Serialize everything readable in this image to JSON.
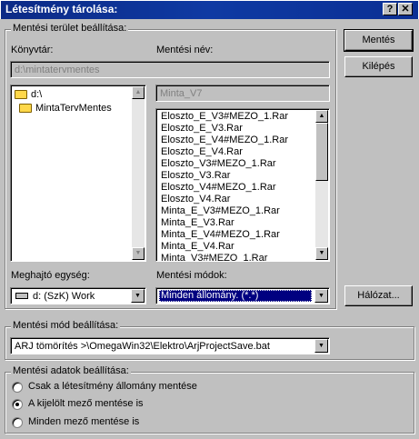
{
  "window": {
    "title": "Létesítmény tárolása:",
    "help_button": "?",
    "close_button": "✕"
  },
  "storage_area": {
    "legend": "Mentési terület beállítása:",
    "directory_label": "Könyvtár:",
    "directory_value": "d:\\mintatervmentes",
    "save_name_label": "Mentési név:",
    "save_name_value": "Minta_V7",
    "folders": [
      "d:\\",
      "MintaTervMentes"
    ],
    "files": [
      "Eloszto_E_V3#MEZO_1.Rar",
      "Eloszto_E_V3.Rar",
      "Eloszto_E_V4#MEZO_1.Rar",
      "Eloszto_E_V4.Rar",
      "Eloszto_V3#MEZO_1.Rar",
      "Eloszto_V3.Rar",
      "Eloszto_V4#MEZO_1.Rar",
      "Eloszto_V4.Rar",
      "Minta_E_V3#MEZO_1.Rar",
      "Minta_E_V3.Rar",
      "Minta_E_V4#MEZO_1.Rar",
      "Minta_E_V4.Rar",
      "Minta_V3#MEZO_1.Rar"
    ],
    "drive_label": "Meghajtó egység:",
    "drive_value": "d: (SzK) Work",
    "save_modes_label": "Mentési módok:",
    "save_modes_value": "Minden állomány. (*.*)"
  },
  "buttons": {
    "save": "Mentés",
    "exit": "Kilépés",
    "network": "Hálózat..."
  },
  "save_mode_settings": {
    "legend": "Mentési mód beállítása:",
    "value": "ARJ tömörítés >\\OmegaWin32\\Elektro\\ArjProjectSave.bat"
  },
  "save_data_settings": {
    "legend": "Mentési adatok beállítása:",
    "options": [
      {
        "label": "Csak a létesítmény állomány mentése",
        "selected": false
      },
      {
        "label": "A kijelölt mező mentése is",
        "selected": true
      },
      {
        "label": "Minden mező mentése is",
        "selected": false
      }
    ]
  },
  "colors": {
    "title_bar": "#0c2a86",
    "dialog_bg": "#c0c0c0",
    "selection": "#000080"
  }
}
